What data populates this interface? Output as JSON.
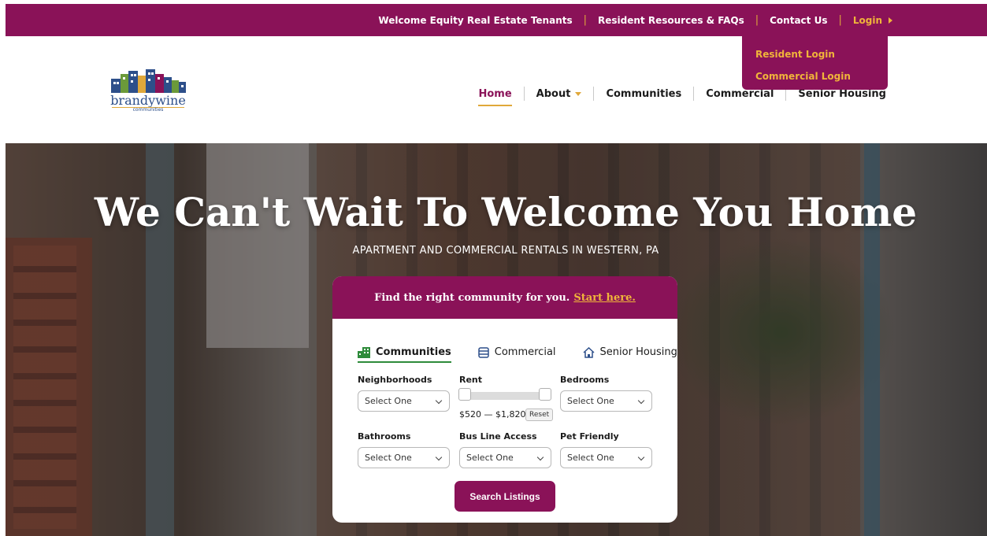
{
  "topbar": {
    "links": [
      "Welcome Equity Real Estate Tenants",
      "Resident Resources & FAQs",
      "Contact Us"
    ],
    "login_label": "Login"
  },
  "login_menu": {
    "items": [
      "Resident Login",
      "Commercial Login"
    ]
  },
  "logo": {
    "name": "brandywine",
    "sub": "communities"
  },
  "nav": {
    "items": [
      "Home",
      "About",
      "Communities",
      "Commercial",
      "Senior Housing"
    ],
    "active": "Home"
  },
  "hero": {
    "title": "We Can't Wait To Welcome You Home",
    "subtitle": "APARTMENT AND COMMERCIAL RENTALS IN WESTERN, PA"
  },
  "search": {
    "header_text": "Find the right community for you.",
    "header_accent": "Start here.",
    "tabs": [
      {
        "label": "Communities",
        "icon": "buildings-icon",
        "active": true
      },
      {
        "label": "Commercial",
        "icon": "storefront-icon",
        "active": false
      },
      {
        "label": "Senior Housing",
        "icon": "house-icon",
        "active": false
      }
    ],
    "fields": {
      "neighborhoods": {
        "label": "Neighborhoods",
        "value": "Select One"
      },
      "rent": {
        "label": "Rent",
        "range_text": "$520 — $1,820",
        "reset": "Reset",
        "min": 520,
        "max": 1820
      },
      "bedrooms": {
        "label": "Bedrooms",
        "value": "Select One"
      },
      "bathrooms": {
        "label": "Bathrooms",
        "value": "Select One"
      },
      "bus_line": {
        "label": "Bus Line Access",
        "value": "Select One"
      },
      "pet_friendly": {
        "label": "Pet Friendly",
        "value": "Select One"
      }
    },
    "submit_label": "Search Listings"
  },
  "colors": {
    "brand": "#8a1258",
    "accent": "#f0b43a",
    "tab_active": "#2e8b3a"
  }
}
